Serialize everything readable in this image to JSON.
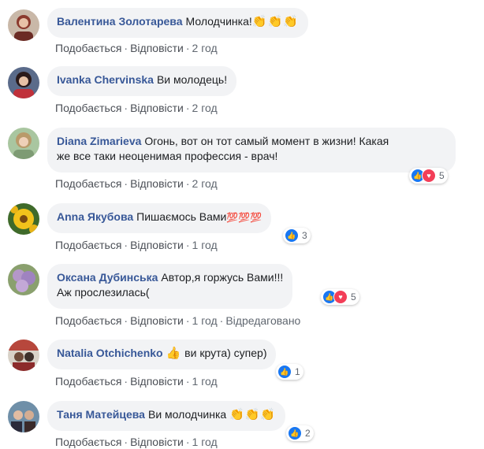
{
  "comments": [
    {
      "author": "Валентина Золотарева",
      "text": "Молодчинка!",
      "emoji": "👏👏👏",
      "like": "Подобається",
      "reply": "Відповісти",
      "time": "2 год",
      "reactions": null
    },
    {
      "author": "Ivanka Chervinska",
      "text": "Ви молодець!",
      "like": "Подобається",
      "reply": "Відповісти",
      "time": "2 год",
      "reactions": null
    },
    {
      "author": "Diana Zimarieva",
      "text_line1": "Огонь, вот он тот самый момент в жизни! Какая",
      "text_line2": "же все таки неоценимая профессия - врач!",
      "like": "Подобається",
      "reply": "Відповісти",
      "time": "2 год",
      "reactions": {
        "types": [
          "like",
          "love"
        ],
        "count": "5"
      }
    },
    {
      "author": "Anna Якубова",
      "text": "Пишаємось Вами",
      "emoji": "💯💯💯",
      "like": "Подобається",
      "reply": "Відповісти",
      "time": "1 год",
      "reactions": {
        "types": [
          "like"
        ],
        "count": "3"
      }
    },
    {
      "author": "Оксана Дубинська",
      "text_line1": "Автор,я горжусь Вами!!!",
      "text_line2": "Аж прослезилась(",
      "like": "Подобається",
      "reply": "Відповісти",
      "time": "1 год",
      "edited": "Відредаговано",
      "reactions": {
        "types": [
          "like",
          "love"
        ],
        "count": "5"
      }
    },
    {
      "author": "Natalia Otchichenko",
      "emoji": "👍",
      "text": "ви крута) супер)",
      "like": "Подобається",
      "reply": "Відповісти",
      "time": "1 год",
      "reactions": {
        "types": [
          "like"
        ],
        "count": "1"
      }
    },
    {
      "author": "Таня Матейцева",
      "text": "Ви молодчинка",
      "emoji": "👏👏👏",
      "like": "Подобається",
      "reply": "Відповісти",
      "time": "1 год",
      "reactions": {
        "types": [
          "like"
        ],
        "count": "2"
      }
    }
  ],
  "dot": "·",
  "colors": {
    "author": "#385898",
    "bubble": "#f2f3f5",
    "meta": "#606770",
    "like": "#1877f2",
    "love": "#f33e58"
  }
}
